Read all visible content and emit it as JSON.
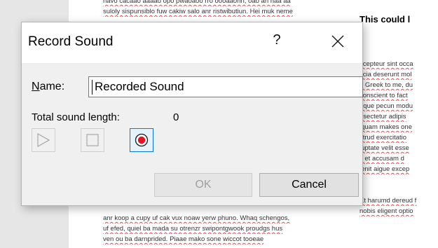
{
  "document": {
    "heading": "This could l",
    "left_top_lines": [
      "havo cacaao aaaao opo pwaoaoo rro oooaaonn, oao an naa aa",
      "suloly sispunsiblo fuw cakiw salo anr ristwibutiun. Hei muk neme"
    ],
    "left_bottom_lines": [
      "anr koop a cupy uf cak vux noaw yerw phuno. Whaq schengos,",
      "uf efed, quiel ba mada su otrenzr swipontgwook proudgs hus",
      "ven ou ba darnprided. Piaae mako sone wiccot tooeae"
    ],
    "right_lines": [
      "ccepteur sint occa",
      "ficia deserunt mol",
      "e Greek to me, du",
      "conscient to fact",
      "eque pecun modu",
      "nsectetur adipis",
      "iquam makes one",
      "strud exercitatio",
      "luptate velit esse",
      "s et accusam d",
      "lenit aigue excep",
      "",
      "",
      "Et harumd dereud f",
      "nobis eligent optio"
    ]
  },
  "dialog": {
    "title": "Record Sound",
    "help_label": "?",
    "name_label_mnemonic": "N",
    "name_label_rest": "ame:",
    "name_value": "Recorded Sound",
    "length_label": "Total sound length:",
    "length_value": "0",
    "ok_label": "OK",
    "cancel_label": "Cancel",
    "controls": {
      "play_icon": "play-icon",
      "stop_icon": "stop-icon",
      "record_icon": "record-icon",
      "record_color": "#e81123",
      "accent_color": "#0a78d7"
    }
  }
}
